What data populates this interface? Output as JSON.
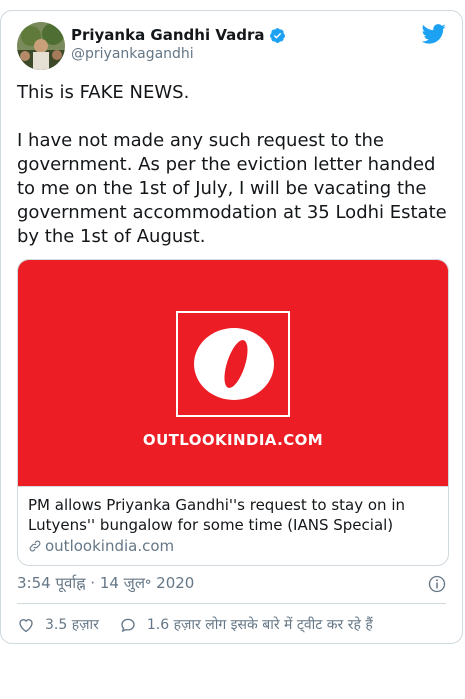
{
  "tweet": {
    "author_name": "Priyanka Gandhi Vadra",
    "handle": "@priyankagandhi",
    "text": "This is FAKE NEWS.\n\nI have not made any such request to the government. As per the eviction letter handed to me on the 1st of July, I will be vacating the government accommodation at 35 Lodhi Estate by the 1st of August.",
    "timestamp": "3:54 पूर्वाह्न · 14 जुल॰ 2020"
  },
  "link_card": {
    "image_logo_text": "OUTLOOKINDIA.COM",
    "title": "PM allows Priyanka Gandhi''s request to stay on in Lutyens'' bungalow for some time (IANS Special)",
    "domain": "outlookindia.com"
  },
  "actions": {
    "likes": "3.5 हज़ार",
    "replies_text": "1.6 हज़ार लोग इसके बारे में ट्वीट कर रहे हैं"
  },
  "colors": {
    "twitter_blue": "#1da1f2",
    "outlook_red": "#ec1d24",
    "secondary_text": "#657786"
  },
  "icons": [
    "verified-badge-icon",
    "twitter-bird-icon",
    "link-icon",
    "info-icon",
    "heart-icon",
    "reply-icon"
  ]
}
